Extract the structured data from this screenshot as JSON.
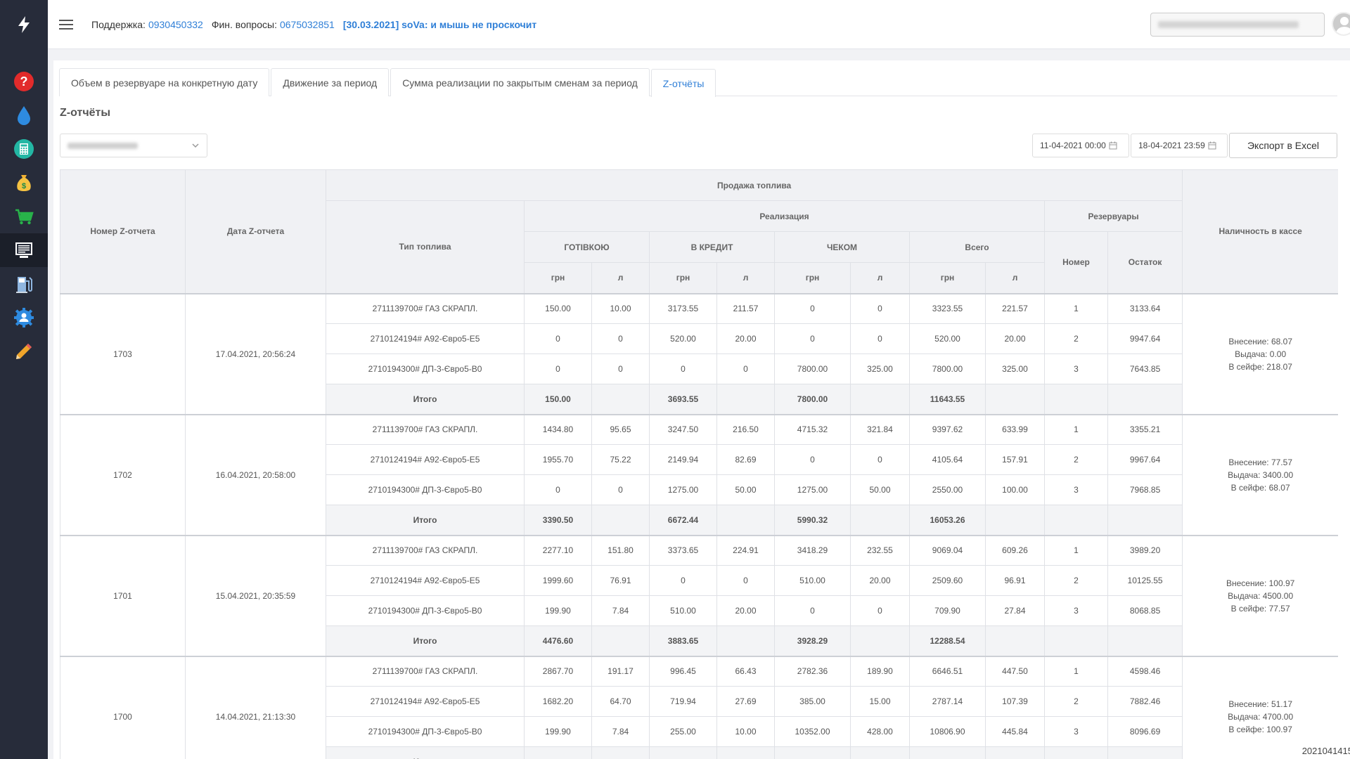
{
  "header": {
    "support_label": "Поддержка:",
    "support_phone": "0930450332",
    "fin_label": "Фин. вопросы:",
    "fin_phone": "0675032851",
    "news": "[30.03.2021] soVa: и мышь не проскочит"
  },
  "sidebar": {
    "items": [
      {
        "name": "help",
        "icon": "question-icon"
      },
      {
        "name": "fuel",
        "icon": "drop-icon"
      },
      {
        "name": "calculator",
        "icon": "calculator-icon"
      },
      {
        "name": "money",
        "icon": "money-bag-icon"
      },
      {
        "name": "cart",
        "icon": "cart-icon"
      },
      {
        "name": "reports",
        "icon": "report-monitor-icon",
        "active": true
      },
      {
        "name": "stations",
        "icon": "fuel-station-icon"
      },
      {
        "name": "settings",
        "icon": "user-settings-icon"
      },
      {
        "name": "edit",
        "icon": "pencil-icon"
      }
    ]
  },
  "tabs": [
    {
      "label": "Объем в резервуаре на конкретную дату"
    },
    {
      "label": "Движение за период"
    },
    {
      "label": "Сумма реализации по закрытым сменам за период"
    },
    {
      "label": "Z-отчёты",
      "active": true
    }
  ],
  "page_title": "Z-отчёты",
  "filters": {
    "date_from": "11-04-2021 00:00",
    "date_to": "18-04-2021 23:59",
    "export_label": "Экспорт в Excel"
  },
  "table": {
    "headers": {
      "z_number": "Номер Z-отчета",
      "z_date": "Дата Z-отчета",
      "fuel_sales": "Продажа топлива",
      "fuel_type": "Тип топлива",
      "sales": "Реализация",
      "cash": "ГОТІВКОЮ",
      "credit": "В КРЕДИТ",
      "check": "ЧЕКОМ",
      "total": "Всего",
      "tanks": "Резервуары",
      "tank_number": "Номер",
      "tank_rest": "Остаток",
      "cash_in_register": "Наличность в кассе",
      "uah": "грн",
      "liters": "л"
    },
    "total_label": "Итого",
    "reports": [
      {
        "number": "1703",
        "date": "17.04.2021, 20:56:24",
        "cash_box": [
          "Внесение: 68.07",
          "Выдача: 0.00",
          "В сейфе: 218.07"
        ],
        "rows": [
          [
            "2711139700# ГАЗ СКРАПЛ.",
            "150.00",
            "10.00",
            "3173.55",
            "211.57",
            "0",
            "0",
            "3323.55",
            "221.57",
            "1",
            "3133.64"
          ],
          [
            "2710124194# А92-Євро5-Е5",
            "0",
            "0",
            "520.00",
            "20.00",
            "0",
            "0",
            "520.00",
            "20.00",
            "2",
            "9947.64"
          ],
          [
            "2710194300# ДП-3-Євро5-В0",
            "0",
            "0",
            "0",
            "0",
            "7800.00",
            "325.00",
            "7800.00",
            "325.00",
            "3",
            "7643.85"
          ]
        ],
        "totals": [
          "150.00",
          "",
          "3693.55",
          "",
          "7800.00",
          "",
          "11643.55",
          "",
          "",
          ""
        ]
      },
      {
        "number": "1702",
        "date": "16.04.2021, 20:58:00",
        "cash_box": [
          "Внесение: 77.57",
          "Выдача: 3400.00",
          "В сейфе: 68.07"
        ],
        "rows": [
          [
            "2711139700# ГАЗ СКРАПЛ.",
            "1434.80",
            "95.65",
            "3247.50",
            "216.50",
            "4715.32",
            "321.84",
            "9397.62",
            "633.99",
            "1",
            "3355.21"
          ],
          [
            "2710124194# А92-Євро5-Е5",
            "1955.70",
            "75.22",
            "2149.94",
            "82.69",
            "0",
            "0",
            "4105.64",
            "157.91",
            "2",
            "9967.64"
          ],
          [
            "2710194300# ДП-3-Євро5-В0",
            "0",
            "0",
            "1275.00",
            "50.00",
            "1275.00",
            "50.00",
            "2550.00",
            "100.00",
            "3",
            "7968.85"
          ]
        ],
        "totals": [
          "3390.50",
          "",
          "6672.44",
          "",
          "5990.32",
          "",
          "16053.26",
          "",
          "",
          ""
        ]
      },
      {
        "number": "1701",
        "date": "15.04.2021, 20:35:59",
        "cash_box": [
          "Внесение: 100.97",
          "Выдача: 4500.00",
          "В сейфе: 77.57"
        ],
        "rows": [
          [
            "2711139700# ГАЗ СКРАПЛ.",
            "2277.10",
            "151.80",
            "3373.65",
            "224.91",
            "3418.29",
            "232.55",
            "9069.04",
            "609.26",
            "1",
            "3989.20"
          ],
          [
            "2710124194# А92-Євро5-Е5",
            "1999.60",
            "76.91",
            "0",
            "0",
            "510.00",
            "20.00",
            "2509.60",
            "96.91",
            "2",
            "10125.55"
          ],
          [
            "2710194300# ДП-3-Євро5-В0",
            "199.90",
            "7.84",
            "510.00",
            "20.00",
            "0",
            "0",
            "709.90",
            "27.84",
            "3",
            "8068.85"
          ]
        ],
        "totals": [
          "4476.60",
          "",
          "3883.65",
          "",
          "3928.29",
          "",
          "12288.54",
          "",
          "",
          ""
        ]
      },
      {
        "number": "1700",
        "date": "14.04.2021, 21:13:30",
        "cash_box": [
          "Внесение: 51.17",
          "Выдача: 4700.00",
          "В сейфе: 100.97"
        ],
        "rows": [
          [
            "2711139700# ГАЗ СКРАПЛ.",
            "2867.70",
            "191.17",
            "996.45",
            "66.43",
            "2782.36",
            "189.90",
            "6646.51",
            "447.50",
            "1",
            "4598.46"
          ],
          [
            "2710124194# А92-Євро5-Е5",
            "1682.20",
            "64.70",
            "719.94",
            "27.69",
            "385.00",
            "15.00",
            "2787.14",
            "107.39",
            "2",
            "7882.46"
          ],
          [
            "2710194300# ДП-3-Євро5-В0",
            "199.90",
            "7.84",
            "255.00",
            "10.00",
            "10352.00",
            "428.00",
            "10806.90",
            "445.84",
            "3",
            "8096.69"
          ]
        ],
        "totals": [
          "",
          "",
          "",
          "",
          "",
          "",
          "",
          "",
          "",
          ""
        ]
      }
    ]
  },
  "footer_stamp": "2021041415"
}
